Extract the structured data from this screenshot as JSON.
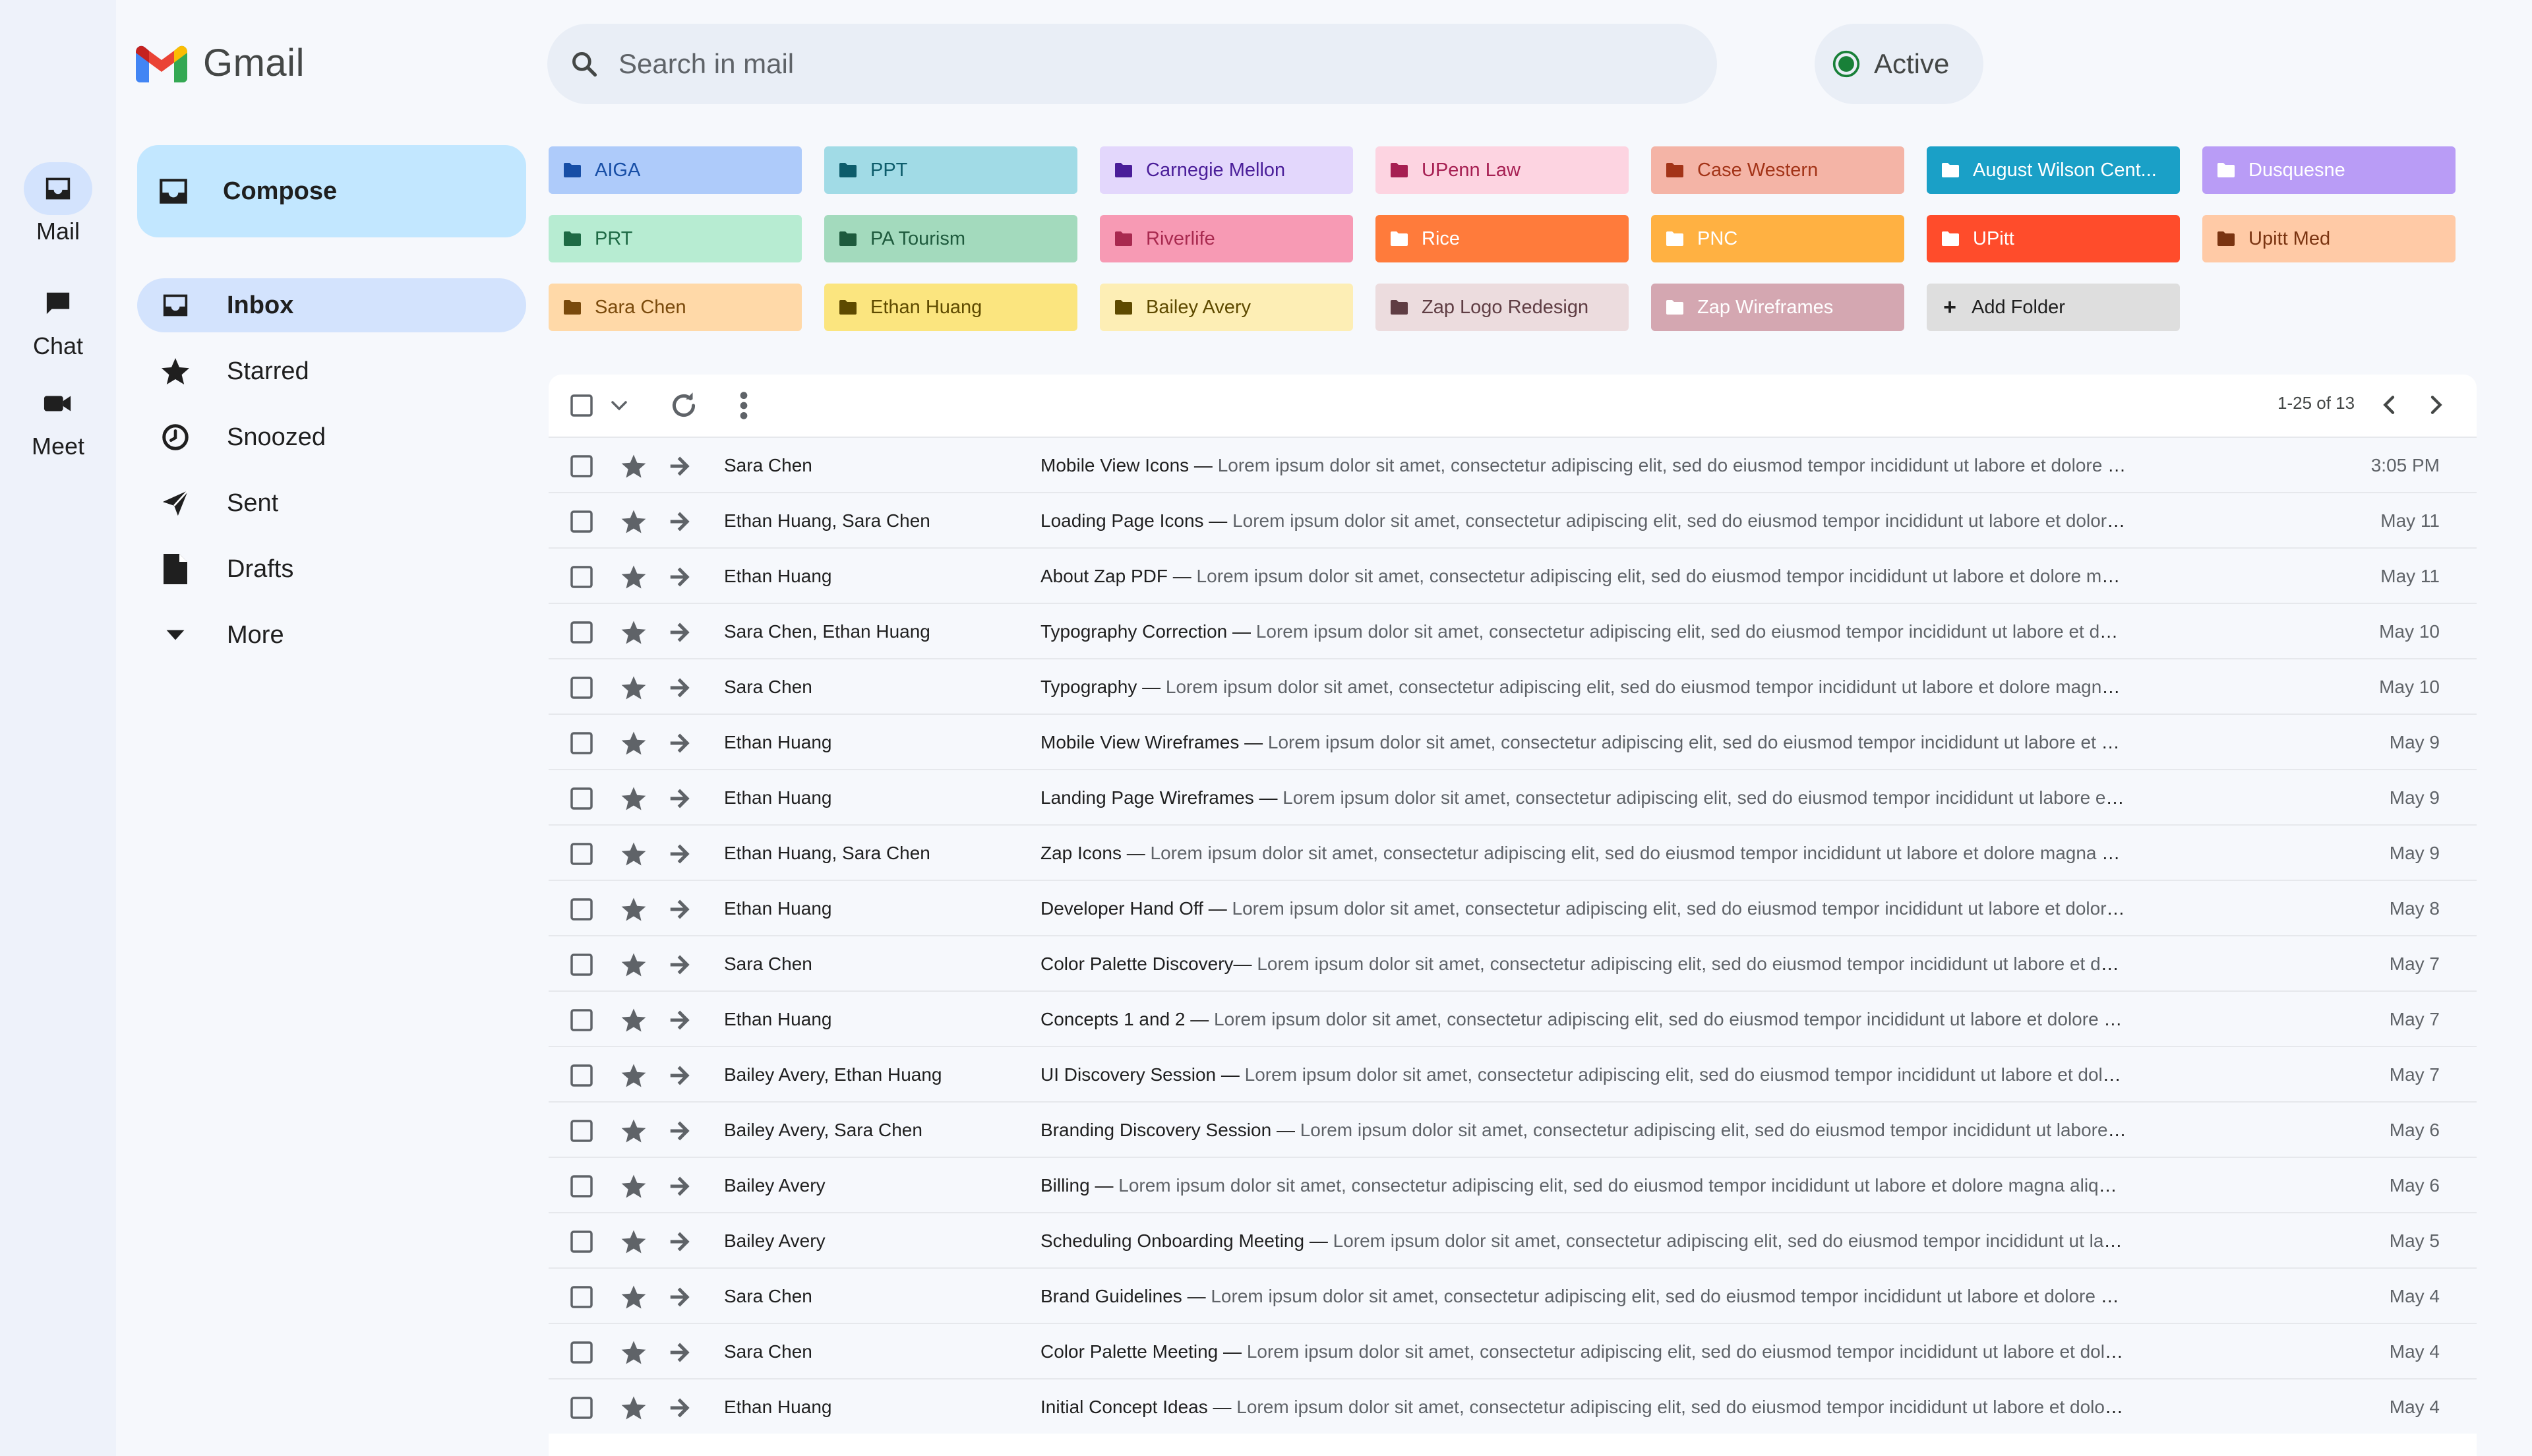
{
  "app": {
    "title": "Gmail"
  },
  "rail": [
    {
      "label": "Mail",
      "icon": "inbox-icon",
      "active": true
    },
    {
      "label": "Chat",
      "icon": "chat-icon",
      "active": false
    },
    {
      "label": "Meet",
      "icon": "video-icon",
      "active": false
    }
  ],
  "search": {
    "placeholder": "Search in mail"
  },
  "status": {
    "label": "Active",
    "color": "#188038"
  },
  "compose": {
    "label": "Compose"
  },
  "nav": [
    {
      "label": "Inbox",
      "icon": "inbox-icon",
      "active": true
    },
    {
      "label": "Starred",
      "icon": "star-icon"
    },
    {
      "label": "Snoozed",
      "icon": "clock-icon"
    },
    {
      "label": "Sent",
      "icon": "send-icon"
    },
    {
      "label": "Drafts",
      "icon": "file-icon"
    },
    {
      "label": "More",
      "icon": "caret-down-icon"
    }
  ],
  "folders": [
    {
      "name": "AIGA",
      "bg": "#aecbfa",
      "fg": "#174ea6"
    },
    {
      "name": "PPT",
      "bg": "#a1dbe6",
      "fg": "#0d5c6b"
    },
    {
      "name": "Carnegie Mellon",
      "bg": "#e3d7fc",
      "fg": "#4a1e99"
    },
    {
      "name": "UPenn Law",
      "bg": "#fdd4e1",
      "fg": "#a61f52"
    },
    {
      "name": "Case Western",
      "bg": "#f4b4a6",
      "fg": "#a33418"
    },
    {
      "name": "August Wilson Cent...",
      "bg": "#1aa0c7",
      "fg": "#ffffff"
    },
    {
      "name": "Dusquesne",
      "bg": "#b99cf6",
      "fg": "#ffffff"
    },
    {
      "name": "PRT",
      "bg": "#b7ecd2",
      "fg": "#1e6a45"
    },
    {
      "name": "PA Tourism",
      "bg": "#a3dabd",
      "fg": "#1e5a3d"
    },
    {
      "name": "Riverlife",
      "bg": "#f79ab4",
      "fg": "#a8294f"
    },
    {
      "name": "Rice",
      "bg": "#ff7b3b",
      "fg": "#ffffff"
    },
    {
      "name": "PNC",
      "bg": "#ffb142",
      "fg": "#ffffff"
    },
    {
      "name": "UPitt",
      "bg": "#ff4c2b",
      "fg": "#ffffff"
    },
    {
      "name": "Upitt Med",
      "bg": "#ffcaa6",
      "fg": "#7a3411"
    },
    {
      "name": "Sara Chen",
      "bg": "#ffd9a8",
      "fg": "#7a4a0c"
    },
    {
      "name": "Ethan Huang",
      "bg": "#fbe57f",
      "fg": "#5e4a00"
    },
    {
      "name": "Bailey Avery",
      "bg": "#fdeeb5",
      "fg": "#5e4a00"
    },
    {
      "name": "Zap Logo Redesign",
      "bg": "#ecdcde",
      "fg": "#5f3d43"
    },
    {
      "name": "Zap Wireframes",
      "bg": "#d4a7b1",
      "fg": "#ffffff"
    },
    {
      "name": "Add Folder",
      "bg": "#dedede",
      "fg": "#1f1f1f",
      "add": true
    }
  ],
  "toolbar": {
    "pagination": "1-25 of 13"
  },
  "emails": [
    {
      "sender": "Sara Chen",
      "subject": "Mobile View Icons —",
      "snippet": " Lorem ipsum dolor sit amet, consectetur adipiscing elit, sed do eiusmod tempor incididunt ut labore et dolore magna aliqua...",
      "date": "3:05 PM"
    },
    {
      "sender": "Ethan Huang, Sara Chen",
      "subject": "Loading Page Icons —",
      "snippet": " Lorem ipsum dolor sit amet, consectetur adipiscing elit, sed do eiusmod tempor incididunt ut labore et dolore magna aliqu...",
      "date": "May 11"
    },
    {
      "sender": "Ethan Huang",
      "subject": "About Zap PDF —",
      "snippet": " Lorem ipsum dolor sit amet, consectetur adipiscing elit, sed do eiusmod tempor incididunt ut labore et dolore magna aliqua. U...",
      "date": "May 11"
    },
    {
      "sender": "Sara Chen, Ethan Huang",
      "subject": "Typography Correction —",
      "snippet": " Lorem ipsum dolor sit amet, consectetur adipiscing elit, sed do eiusmod tempor incididunt ut labore et dolore magna al...",
      "date": "May 10"
    },
    {
      "sender": "Sara Chen",
      "subject": "Typography —",
      "snippet": " Lorem ipsum dolor sit amet, consectetur adipiscing elit, sed do eiusmod tempor incididunt ut labore et dolore magna aliqua. Ut en...",
      "date": "May 10"
    },
    {
      "sender": "Ethan Huang",
      "subject": "Mobile View Wireframes —",
      "snippet": " Lorem ipsum dolor sit amet, consectetur adipiscing elit, sed do eiusmod tempor incididunt ut labore et dolore magna ...",
      "date": "May 9"
    },
    {
      "sender": "Ethan Huang",
      "subject": "Landing Page Wireframes —",
      "snippet": " Lorem ipsum dolor sit amet, consectetur adipiscing elit, sed do eiusmod tempor incididunt ut labore et dolore magn...",
      "date": "May 9"
    },
    {
      "sender": "Ethan Huang, Sara Chen",
      "subject": "Zap Icons — ",
      "snippet": " Lorem ipsum dolor sit amet, consectetur adipiscing elit, sed do eiusmod tempor incididunt ut labore et dolore magna aliqua. Ut en...",
      "date": "May 9"
    },
    {
      "sender": "Ethan Huang",
      "subject": "Developer Hand Off — ",
      "snippet": " Lorem ipsum dolor sit amet, consectetur adipiscing elit, sed do eiusmod tempor incididunt ut labore et dolore magna aliq...",
      "date": "May 8"
    },
    {
      "sender": "Sara Chen",
      "subject": "Color Palette Discovery—",
      "snippet": " Lorem ipsum dolor sit amet, consectetur adipiscing elit, sed do eiusmod tempor incididunt ut labore et dolore magna al...",
      "date": "May 7"
    },
    {
      "sender": "Ethan Huang",
      "subject": "Concepts 1 and 2 — ",
      "snippet": " Lorem ipsum dolor sit amet, consectetur adipiscing elit, sed do eiusmod tempor incididunt ut labore et dolore magna aliqua...",
      "date": "May 7"
    },
    {
      "sender": "Bailey Avery, Ethan Huang",
      "subject": "UI Discovery Session —",
      "snippet": " Lorem ipsum dolor sit amet, consectetur adipiscing elit, sed do eiusmod tempor incididunt ut labore et dolore magna aliq...",
      "date": "May 7"
    },
    {
      "sender": "Bailey Avery, Sara Chen",
      "subject": "Branding Discovery Session —",
      "snippet": " Lorem ipsum dolor sit amet, consectetur adipiscing elit, sed do eiusmod tempor incididunt ut labore et dolore ma...",
      "date": "May 6"
    },
    {
      "sender": "Bailey Avery",
      "subject": "Billing —",
      "snippet": " Lorem ipsum dolor sit amet, consectetur adipiscing elit, sed do eiusmod tempor incididunt ut labore et dolore magna aliqua. Ut enim ad...",
      "date": "May 6"
    },
    {
      "sender": "Bailey Avery",
      "subject": "Scheduling Onboarding Meeting —",
      "snippet": " Lorem ipsum dolor sit amet, consectetur adipiscing elit, sed do eiusmod tempor incididunt ut labore et dolore ...",
      "date": "May 5"
    },
    {
      "sender": "Sara Chen",
      "subject": "Brand Guidelines —",
      "snippet": " Lorem ipsum dolor sit amet, consectetur adipiscing elit, sed do eiusmod tempor incididunt ut labore et dolore magna aliqua ...",
      "date": "May 4"
    },
    {
      "sender": "Sara Chen",
      "subject": "Color Palette Meeting —",
      "snippet": " Lorem ipsum dolor sit amet, consectetur adipiscing elit, sed do eiusmod tempor incididunt ut labore et dolore magna ali...",
      "date": "May 4"
    },
    {
      "sender": "Ethan Huang",
      "subject": "Initial Concept Ideas —",
      "snippet": " Lorem ipsum dolor sit amet, consectetur adipiscing elit, sed do eiusmod tempor incididunt ut labore et dolore magna aliq...",
      "date": "May 4"
    }
  ]
}
